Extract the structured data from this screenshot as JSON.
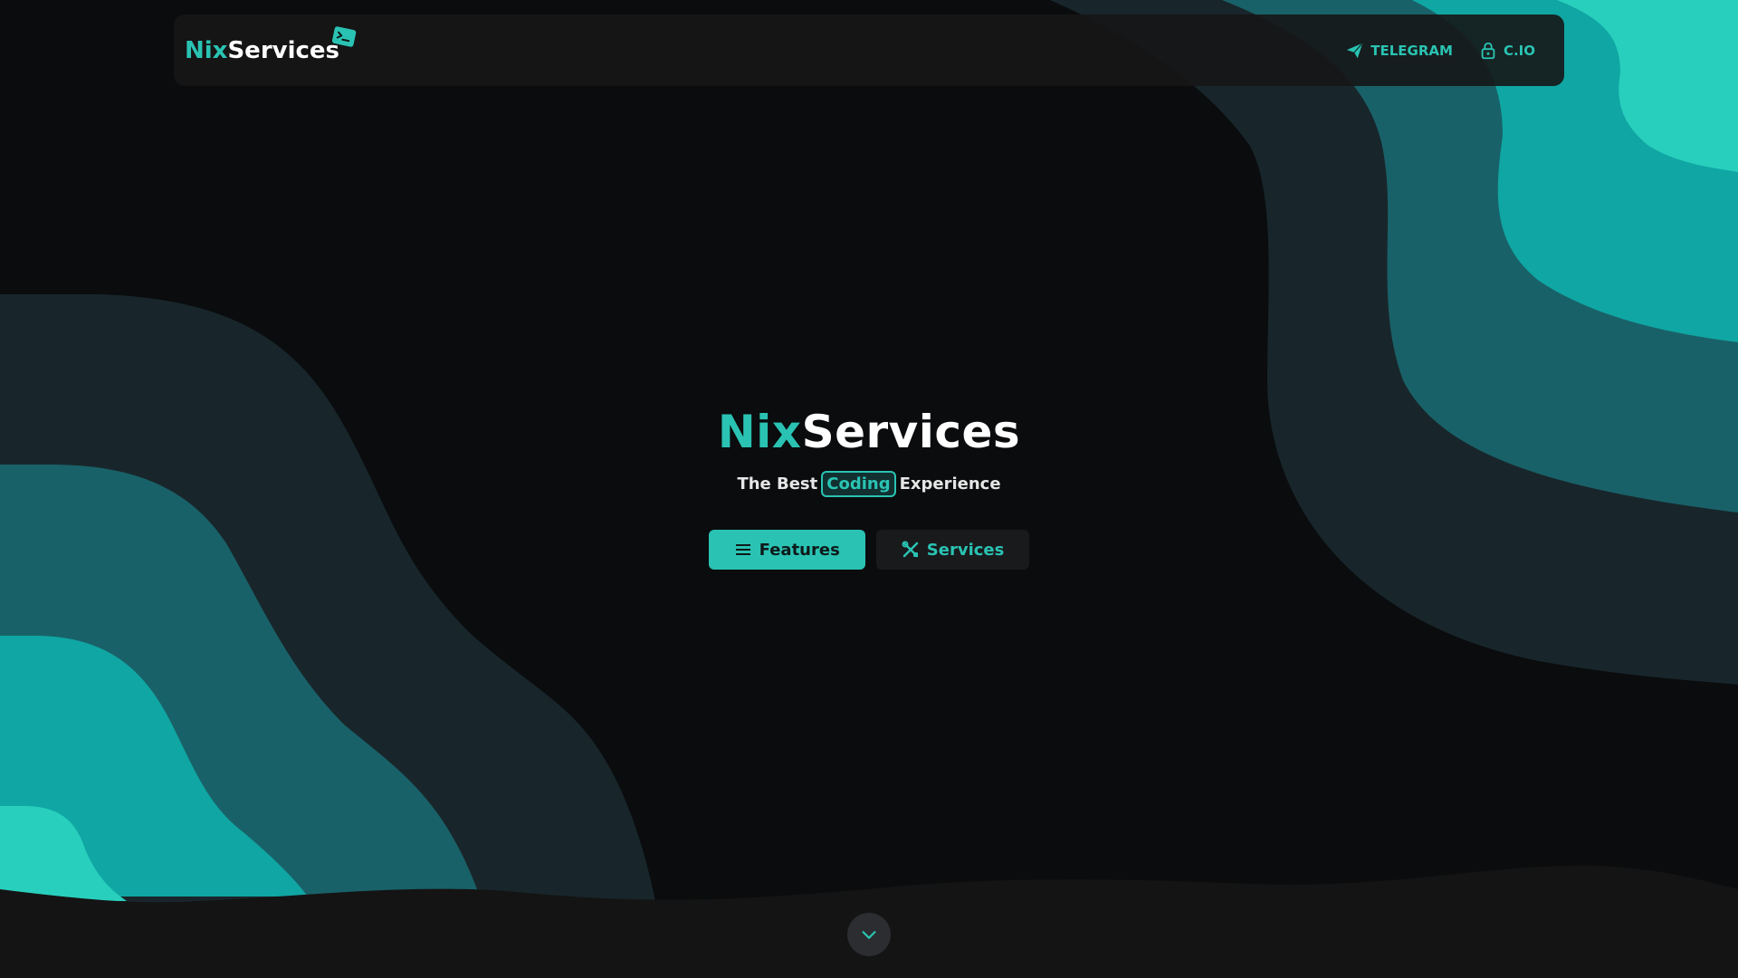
{
  "brand": {
    "part1": "Nix",
    "part2": "Services"
  },
  "nav": {
    "links": [
      {
        "label": "TELEGRAM",
        "icon": "paper-plane-icon"
      },
      {
        "label": "C.IO",
        "icon": "lock-icon"
      }
    ]
  },
  "hero": {
    "title_part1": "Nix",
    "title_part2": "Services",
    "subtitle_before": "The Best",
    "subtitle_highlight": "Coding",
    "subtitle_after": "Experience"
  },
  "buttons": {
    "features": {
      "label": "Features",
      "icon": "menu-lines-icon"
    },
    "services": {
      "label": "Services",
      "icon": "tools-icon"
    }
  },
  "scroll": {
    "icon": "chevron-down-icon"
  },
  "colors": {
    "accent": "#2ac3b3",
    "background": "#0a0c0e",
    "wave_dark": "#18262b",
    "wave_mid": "#196168",
    "wave_teal": "#0fa6a3",
    "wave_light": "#29cfbd",
    "footer": "#141414"
  }
}
